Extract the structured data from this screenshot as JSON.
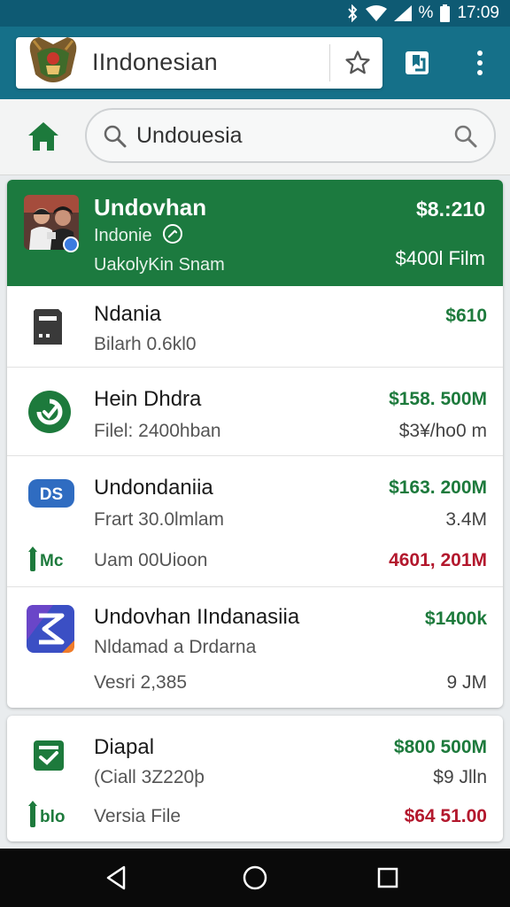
{
  "status_bar": {
    "battery_percent_label": "%",
    "time": "17:09"
  },
  "app_bar": {
    "title": "IIndonesian"
  },
  "search": {
    "value": "Undouesia",
    "placeholder": ""
  },
  "featured": {
    "title": "Undovhan",
    "subtitle": "Indonie",
    "meta": "UakolyKin Snam",
    "price": "$8.:210",
    "price2": "$400l Film",
    "color": "#1c7a3f"
  },
  "rows": [
    {
      "icon": "sim-card-icon",
      "title": "Ndania",
      "subtitle": "Bilarh 0.6kl0",
      "price": "$610"
    },
    {
      "icon": "refresh-check-icon",
      "title": "Hein Dhdra",
      "subtitle": "Filel: 2400hban",
      "price": "$158. 500M",
      "sub2": "$3¥/ho0 m"
    },
    {
      "icon": "ds-logo-icon",
      "title": "Undondaniia",
      "subtitle": "Frart 30.0lmlam",
      "price": "$163. 200M",
      "sub2": "3.4M",
      "tag": "Mc",
      "tag_text": "Uam 00Uioon",
      "red": "4601, 201M"
    },
    {
      "icon": "hourglass-app-icon",
      "title": "Undovhan IIndanasiia",
      "subtitle": "Nldamad a Drdarna",
      "price": "$1400k",
      "sub3": "Vesri  2,385",
      "sub2": "9 JM"
    }
  ],
  "card2": {
    "icon": "check-document-icon",
    "title": "Diapal",
    "subtitle": "(Ciall 3Z220þ",
    "price": "$800 500M",
    "sub2": "$9 Jlln",
    "tag": "blo",
    "tag_text": "Versia File",
    "red": "$64 51.00"
  },
  "colors": {
    "status_bar": "#0e5a73",
    "app_bar": "#157089",
    "accent_green": "#1d7a3c",
    "negative_red": "#b3182d"
  }
}
